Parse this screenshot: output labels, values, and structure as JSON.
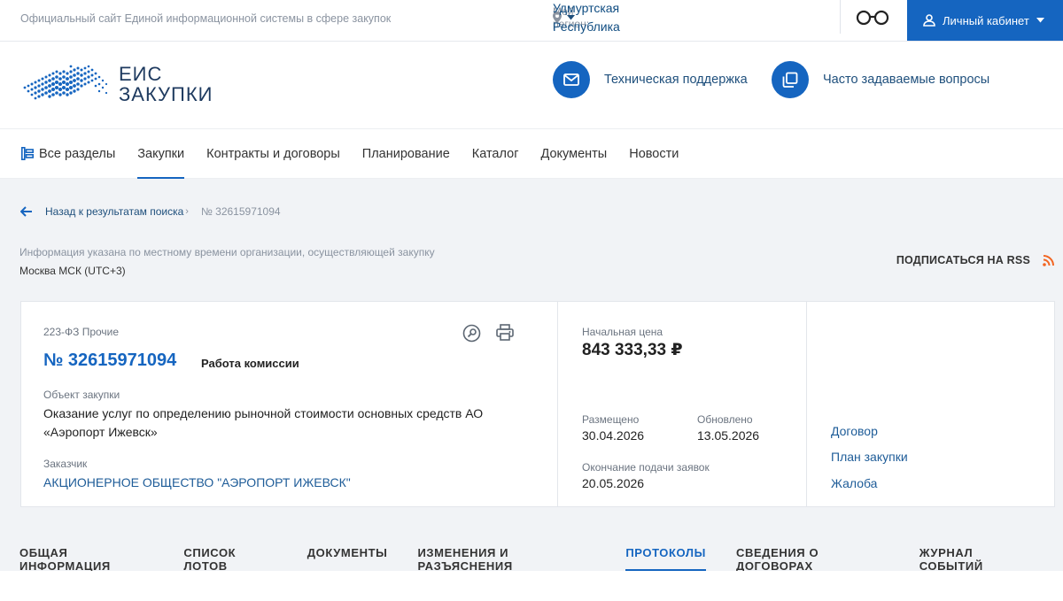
{
  "topbar": {
    "site_title": "Официальный сайт Единой информационной системы в сфере закупок",
    "region_label": "Мой регион:",
    "region_value": "Удмуртская Республика",
    "cabinet_label": "Личный кабинет"
  },
  "header": {
    "logo_line1": "ЕИС",
    "logo_line2": "ЗАКУПКИ",
    "support_label": "Техническая поддержка",
    "faq_label": "Часто задаваемые вопросы"
  },
  "nav": {
    "items": [
      {
        "label": "Все разделы"
      },
      {
        "label": "Закупки"
      },
      {
        "label": "Контракты и договоры"
      },
      {
        "label": "Планирование"
      },
      {
        "label": "Каталог"
      },
      {
        "label": "Документы"
      },
      {
        "label": "Новости"
      }
    ]
  },
  "breadcrumb": {
    "back_label": "Назад к результатам поиска",
    "current": "№ 32615971094"
  },
  "tz": {
    "info": "Информация указана по местному времени организации, осуществляющей закупку",
    "value": "Москва МСК (UTC+3)"
  },
  "rss_label": "ПОДПИСАТЬСЯ НА RSS",
  "card": {
    "law": "223-ФЗ Прочие",
    "number": "№ 32615971094",
    "stage": "Работа комиссии",
    "object_label": "Объект закупки",
    "object_line1": "Оказание услуг по определению рыночной стоимости основных средств АО",
    "object_line2": "«Аэропорт Ижевск»",
    "customer_label": "Заказчик",
    "customer": "АКЦИОНЕРНОЕ ОБЩЕСТВО \"АЭРОПОРТ ИЖЕВСК\"",
    "price_label": "Начальная цена",
    "price": "843 333,33 ₽",
    "posted_label": "Размещено",
    "posted": "30.04.2026",
    "updated_label": "Обновлено",
    "updated": "13.05.2026",
    "deadline_label": "Окончание подачи заявок",
    "deadline": "20.05.2026",
    "links": [
      "Договор",
      "План закупки",
      "Жалоба"
    ]
  },
  "tabs": [
    {
      "label": "ОБЩАЯ ИНФОРМАЦИЯ"
    },
    {
      "label": "СПИСОК ЛОТОВ"
    },
    {
      "label": "ДОКУМЕНТЫ"
    },
    {
      "label": "ИЗМЕНЕНИЯ И РАЗЪЯСНЕНИЯ"
    },
    {
      "label": "ПРОТОКОЛЫ"
    },
    {
      "label": "СВЕДЕНИЯ О ДОГОВОРАХ"
    },
    {
      "label": "ЖУРНАЛ СОБЫТИЙ"
    }
  ],
  "colors": {
    "accent": "#1565c0",
    "link": "#1e5c98",
    "rss": "#f26522",
    "page_bg": "#f1f3f6"
  }
}
